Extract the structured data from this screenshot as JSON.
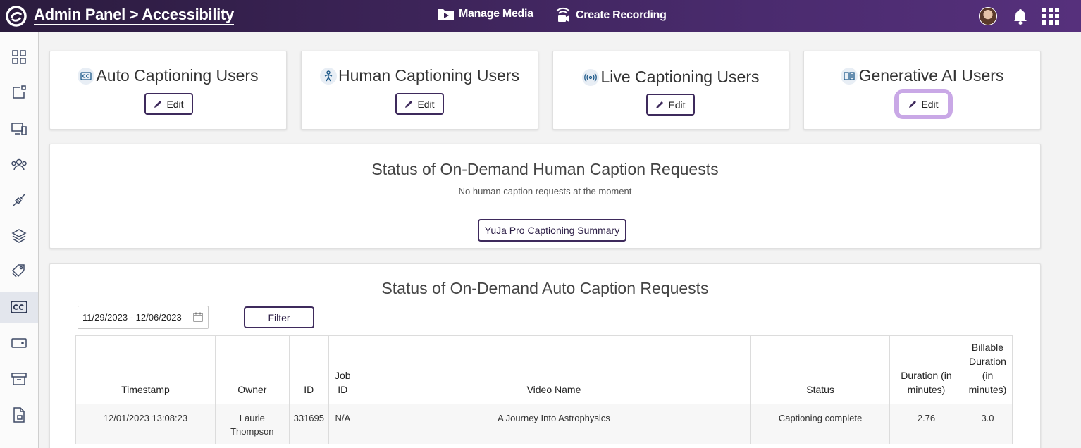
{
  "header": {
    "title": "Admin Panel > Accessibility",
    "manage_media": "Manage Media",
    "create_recording": "Create Recording"
  },
  "sidebar": {
    "items": [
      "dashboard-icon",
      "content-icon",
      "devices-icon",
      "users-icon",
      "integrations-icon",
      "layers-icon",
      "billing-icon",
      "captions-icon",
      "storage-icon",
      "archive-icon",
      "reports-icon"
    ],
    "active": "captions-icon"
  },
  "cards": [
    {
      "title": "Auto Captioning Users",
      "edit_label": "Edit",
      "icon": "cc-icon"
    },
    {
      "title": "Human Captioning Users",
      "edit_label": "Edit",
      "icon": "person-icon"
    },
    {
      "title": "Live Captioning Users",
      "edit_label": "Edit",
      "icon": "broadcast-icon"
    },
    {
      "title": "Generative AI Users",
      "edit_label": "Edit",
      "icon": "book-icon"
    }
  ],
  "human_requests": {
    "title": "Status of On-Demand Human Caption Requests",
    "empty_text": "No human caption requests at the moment",
    "summary_button": "YuJa Pro Captioning Summary"
  },
  "auto_requests": {
    "title": "Status of On-Demand Auto Caption Requests",
    "date_range": "11/29/2023 - 12/06/2023",
    "filter_label": "Filter",
    "columns": [
      "Timestamp",
      "Owner",
      "ID",
      "Job ID",
      "Video Name",
      "Status",
      "Duration (in minutes)",
      "Billable Duration (in minutes)"
    ],
    "rows": [
      {
        "timestamp": "12/01/2023 13:08:23",
        "owner": "Laurie Thompson",
        "id": "331695",
        "job_id": "N/A",
        "video_name": "A Journey Into Astrophysics",
        "status": "Captioning complete",
        "duration": "2.76",
        "billable": "3.0"
      }
    ]
  },
  "colors": {
    "header_start": "#2a1b3d",
    "header_end": "#56307c",
    "accent": "#3e2a5c",
    "focus_ring": "#c9a8e6"
  }
}
